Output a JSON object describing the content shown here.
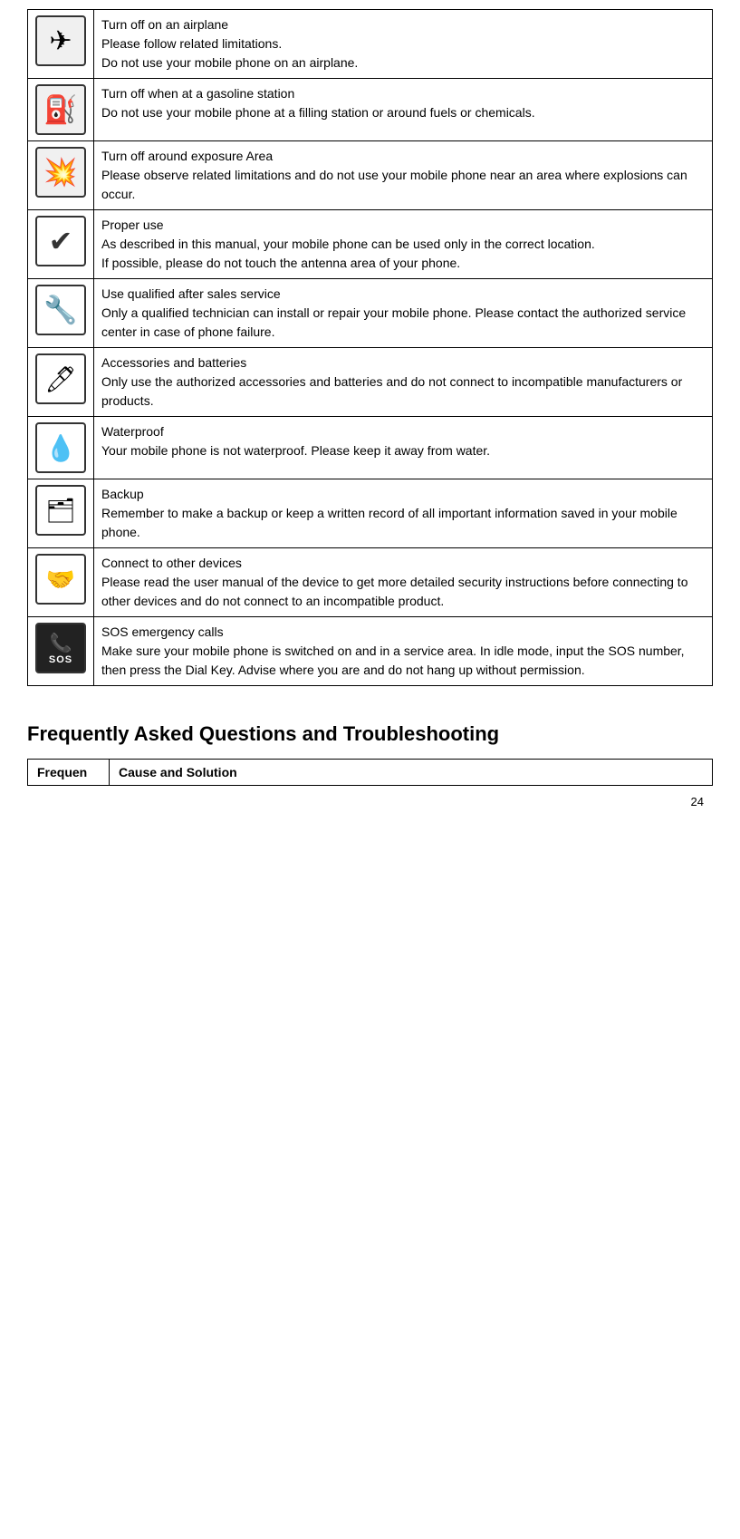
{
  "safety_rows": [
    {
      "icon": "✈",
      "icon_name": "airplane",
      "title": "Turn off on an airplane",
      "description": "Please follow related limitations.\nDo not use your mobile phone on an airplane."
    },
    {
      "icon": "⛽",
      "icon_name": "gas-station",
      "title": "Turn off when at a gasoline station",
      "description": "Do not use your mobile phone at a filling station or around fuels or chemicals."
    },
    {
      "icon": "💥",
      "icon_name": "explosion",
      "title": "Turn off around exposure Area",
      "description": "Please observe related limitations and do not use your mobile phone near an area where explosions can occur."
    },
    {
      "icon": "✔",
      "icon_name": "checkmark",
      "title": "Proper use",
      "description": "As described in this manual, your mobile phone can be used only in the correct location.\nIf possible, please do not touch the antenna area of your phone."
    },
    {
      "icon": "🔧",
      "icon_name": "wrench",
      "title": "Use qualified after sales service",
      "description": "Only a qualified technician can install or repair your mobile phone. Please contact the authorized service center in case of phone failure."
    },
    {
      "icon": "🔌",
      "icon_name": "accessories",
      "title": "Accessories and batteries",
      "description": "Only use the authorized accessories and batteries and do not connect to incompatible manufacturers or products."
    },
    {
      "icon": "💧",
      "icon_name": "water-drops",
      "title": "Waterproof",
      "description": "Your mobile phone is not waterproof. Please keep it away from water."
    },
    {
      "icon": "🗂",
      "icon_name": "backup",
      "title": "Backup",
      "description": "Remember to make a backup or keep a written record of all important information saved in your mobile phone."
    },
    {
      "icon": "🤝",
      "icon_name": "connect",
      "title": "Connect to other devices",
      "description": "Please read the user manual of the device to get more detailed security instructions before connecting to other devices and do not connect to an incompatible product."
    },
    {
      "icon": "SOS",
      "icon_name": "sos",
      "title": "SOS emergency calls",
      "description": "Make sure your mobile phone is switched on and in a service area. In idle mode, input the SOS number, then press the Dial Key. Advise where you are and do not hang up without permission."
    }
  ],
  "faq": {
    "section_title": "Frequently Asked Questions and Troubleshooting",
    "col1_header": "Frequen",
    "col2_header": "Cause and Solution"
  },
  "page_number": "24"
}
